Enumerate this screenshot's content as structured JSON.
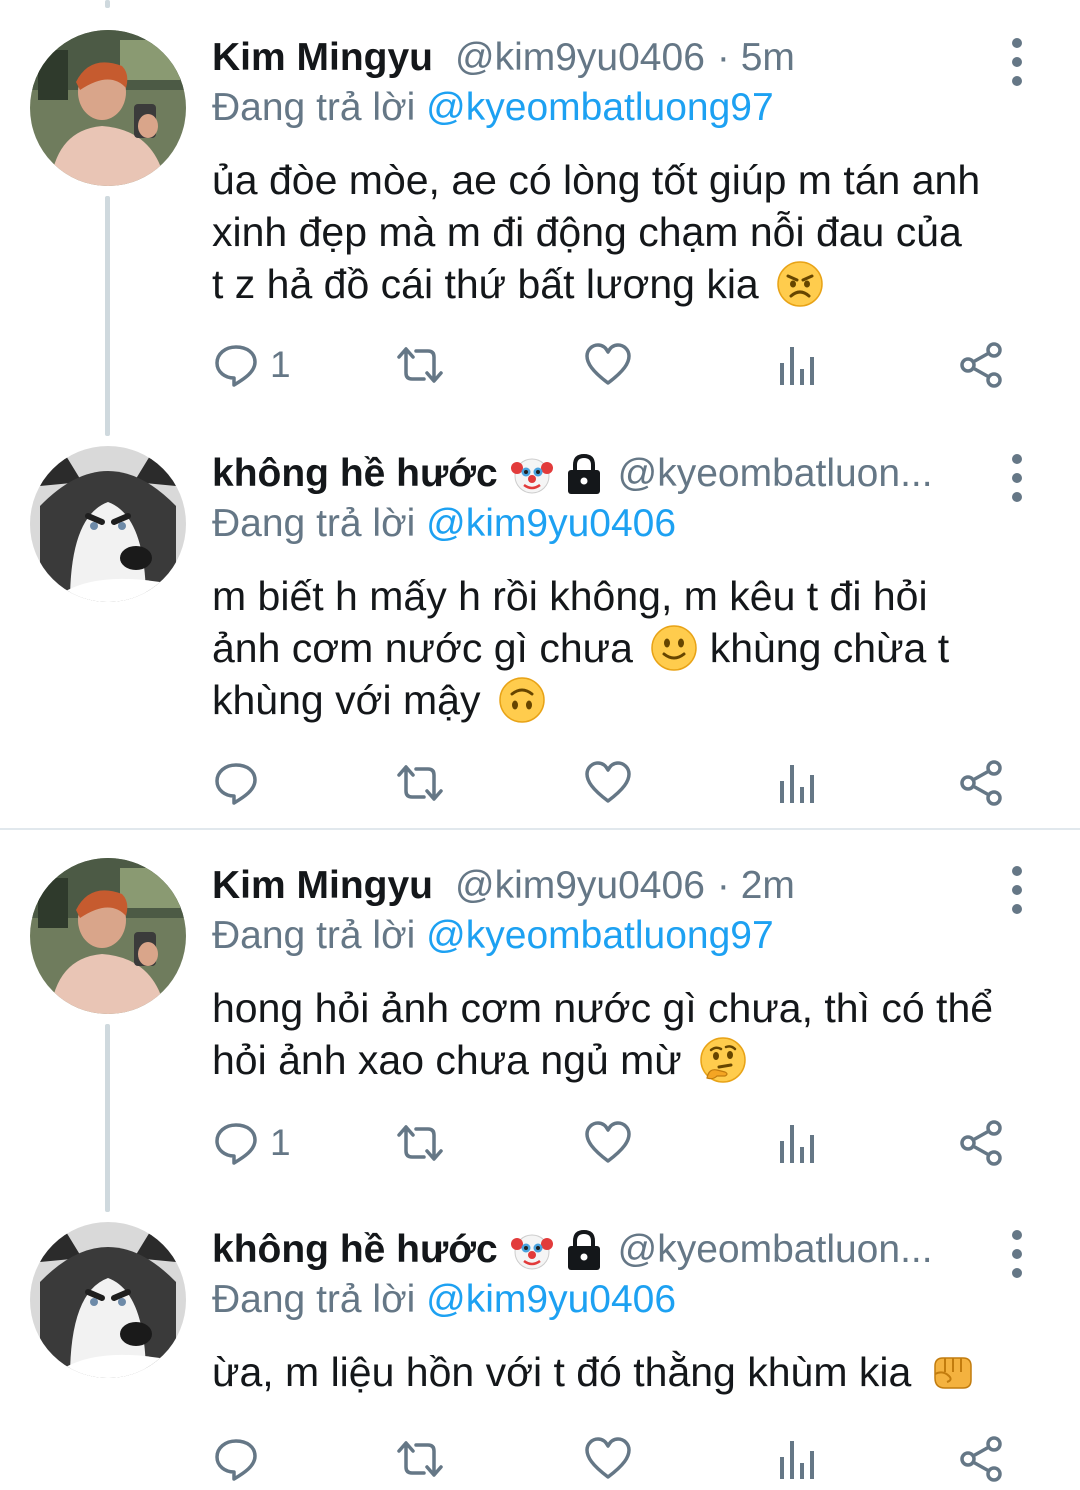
{
  "tweets": [
    {
      "name": "Kim Mingyu",
      "handle": "@kim9yu0406",
      "time": "· 5m",
      "reply_prefix": "Đang trả lời",
      "reply_to": "@kyeombatluong97",
      "lines": [
        "ủa đòe mòe, ae có lòng tốt giúp m tán anh",
        "xinh đẹp mà m đi động chạm nỗi đau của",
        "t z hả đồ cái thứ bất lương kia"
      ],
      "end_emoji": "angry-face",
      "reply_count": "1",
      "avatar": "person-photo"
    },
    {
      "name": "không hề hước",
      "handle": "@kyeombatluon...",
      "time": "",
      "reply_prefix": "Đang trả lời",
      "reply_to": "@kim9yu0406",
      "lines": [
        "m biết h mấy h rồi không, m kêu t đi hỏi",
        "ảnh cơm nước gì chưa",
        "khùng chừa t",
        "khùng với mậy"
      ],
      "end_emoji": "upside-down-face",
      "reply_count": "",
      "avatar": "husky-photo"
    },
    {
      "name": "Kim Mingyu",
      "handle": "@kim9yu0406",
      "time": "· 2m",
      "reply_prefix": "Đang trả lời",
      "reply_to": "@kyeombatluong97",
      "lines": [
        "hong hỏi ảnh cơm nước gì chưa, thì có thể",
        "hỏi ảnh xao chưa ngủ mừ"
      ],
      "end_emoji": "thinking-face",
      "reply_count": "1",
      "avatar": "person-photo"
    },
    {
      "name": "không hề hước",
      "handle": "@kyeombatluon...",
      "time": "",
      "reply_prefix": "Đang trả lời",
      "reply_to": "@kim9yu0406",
      "lines": [
        "ừa, m liệu hồn với t đó thằng khùm kia"
      ],
      "end_emoji": "oncoming-fist",
      "reply_count": "",
      "avatar": "husky-photo"
    }
  ],
  "colors": {
    "link": "#1da1f2",
    "secondary_text": "#657786",
    "primary_text": "#14171a",
    "divider": "#e1e8ed"
  }
}
